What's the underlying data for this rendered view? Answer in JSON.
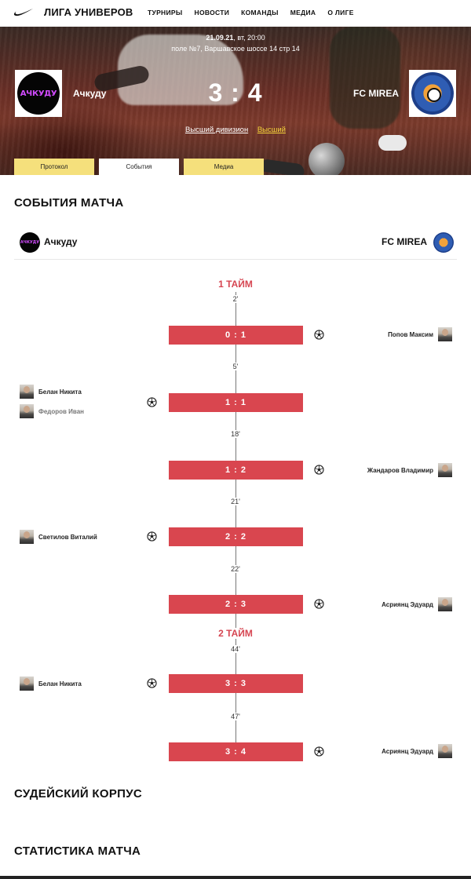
{
  "nav": {
    "brand": "ЛИГА УНИВЕРОВ",
    "menu": [
      "ТУРНИРЫ",
      "НОВОСТИ",
      "КОМАНДЫ",
      "МЕДИА",
      "О ЛИГЕ"
    ]
  },
  "match": {
    "date": "21.09.21",
    "date_suffix": ", вт, 20:00",
    "place": "поле №7, Варшавское шоссе 14 стр 14",
    "home": {
      "name": "Ачкуду",
      "logo_text": "АЧКУДУ"
    },
    "away": {
      "name": "FC MIREA"
    },
    "score": "3 : 4",
    "division_link": "Высший дивизион",
    "league_link": "Высший"
  },
  "tabs": [
    "Протокол",
    "События",
    "Медиа"
  ],
  "sections": {
    "events_title": "СОБЫТИЯ МАТЧА",
    "referees_title": "СУДЕЙСКИЙ КОРПУС",
    "stats_title": "СТАТИСТИКА МАТЧА"
  },
  "events": {
    "half1": "1 ТАЙМ",
    "half2": "2 ТАЙМ",
    "goals": [
      {
        "minute": "2'",
        "score": "0 : 1",
        "side": "away",
        "player": "Попов Максим"
      },
      {
        "minute": "5'",
        "score": "1 : 1",
        "side": "home",
        "player": "Белан Никита",
        "assist": "Федоров Иван"
      },
      {
        "minute": "18'",
        "score": "1 : 2",
        "side": "away",
        "player": "Жандаров Владимир"
      },
      {
        "minute": "21'",
        "score": "2 : 2",
        "side": "home",
        "player": "Светилов Виталий"
      },
      {
        "minute": "22'",
        "score": "2 : 3",
        "side": "away",
        "player": "Асриянц Эдуард"
      },
      {
        "minute": "44'",
        "score": "3 : 3",
        "side": "home",
        "player": "Белан Никита"
      },
      {
        "minute": "47'",
        "score": "3 : 4",
        "side": "away",
        "player": "Асриянц Эдуард"
      }
    ]
  },
  "colors": {
    "accent": "#d9464f",
    "tab_yellow": "#f5e07c",
    "link_yellow": "#f5d33a"
  }
}
